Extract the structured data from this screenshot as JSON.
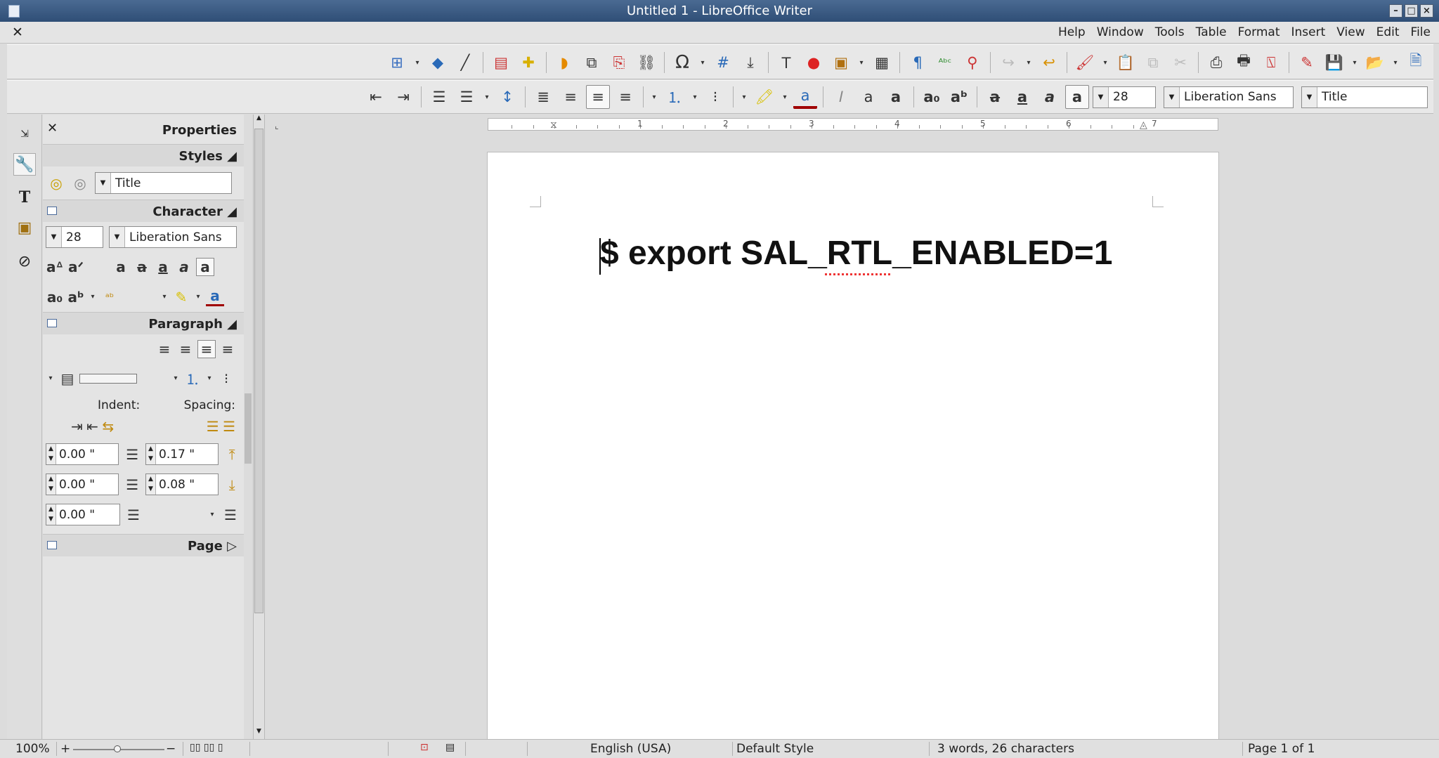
{
  "window": {
    "title": "Untitled 1 - LibreOffice Writer"
  },
  "menubar": {
    "items": [
      "Help",
      "Window",
      "Tools",
      "Table",
      "Format",
      "Insert",
      "View",
      "Edit",
      "File"
    ]
  },
  "format_toolbar": {
    "font_size": "28",
    "font_name": "Liberation Sans",
    "para_style": "Title"
  },
  "sidebar": {
    "title": "Properties",
    "styles": {
      "title": "Styles",
      "value": "Title"
    },
    "character": {
      "title": "Character",
      "font_size": "28",
      "font_name": "Liberation Sans"
    },
    "paragraph": {
      "title": "Paragraph",
      "indent_label": "Indent:",
      "spacing_label": "Spacing:",
      "indent_before": "0.00 \"",
      "indent_after": "0.00 \"",
      "first_line": "0.00 \"",
      "spacing_above": "0.17 \"",
      "spacing_below": "0.08 \""
    },
    "page": {
      "title": "Page"
    }
  },
  "ruler": {
    "numbers": [
      "1",
      "2",
      "3",
      "4",
      "5",
      "6",
      "7"
    ]
  },
  "document": {
    "text": "$ export SAL_RTL_ENABLED=1"
  },
  "statusbar": {
    "zoom": "100%",
    "zoom_minus": "−",
    "zoom_plus": "+",
    "language": "English (USA)",
    "page_style": "Default Style",
    "word_count": "3 words, 26 characters",
    "page": "Page 1 of 1"
  }
}
